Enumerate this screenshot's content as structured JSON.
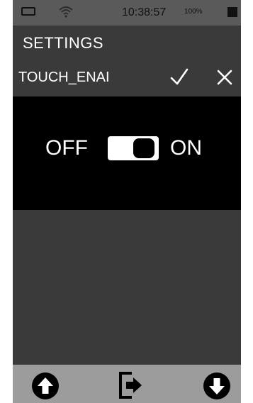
{
  "status_bar": {
    "time": "10:38:57",
    "battery_percent": "100%",
    "icons": [
      "battery-outline-icon",
      "wifi-icon",
      "signal-block-icon"
    ]
  },
  "header": {
    "title": "SETTINGS"
  },
  "parameter": {
    "name": "TOUCH_ENAI",
    "confirm_icon": "checkmark-icon",
    "cancel_icon": "close-icon"
  },
  "toggle": {
    "off_label": "OFF",
    "on_label": "ON",
    "state": "on"
  },
  "bottom_nav": {
    "icons": [
      "arrow-up-circle-icon",
      "exit-icon",
      "arrow-down-circle-icon"
    ]
  },
  "colors": {
    "background": "#3a3a3a",
    "status_bar": "#5a5a5a",
    "toggle_panel": "#000000",
    "bottom_bar": "#9c9c9c",
    "text": "#ffffff"
  }
}
